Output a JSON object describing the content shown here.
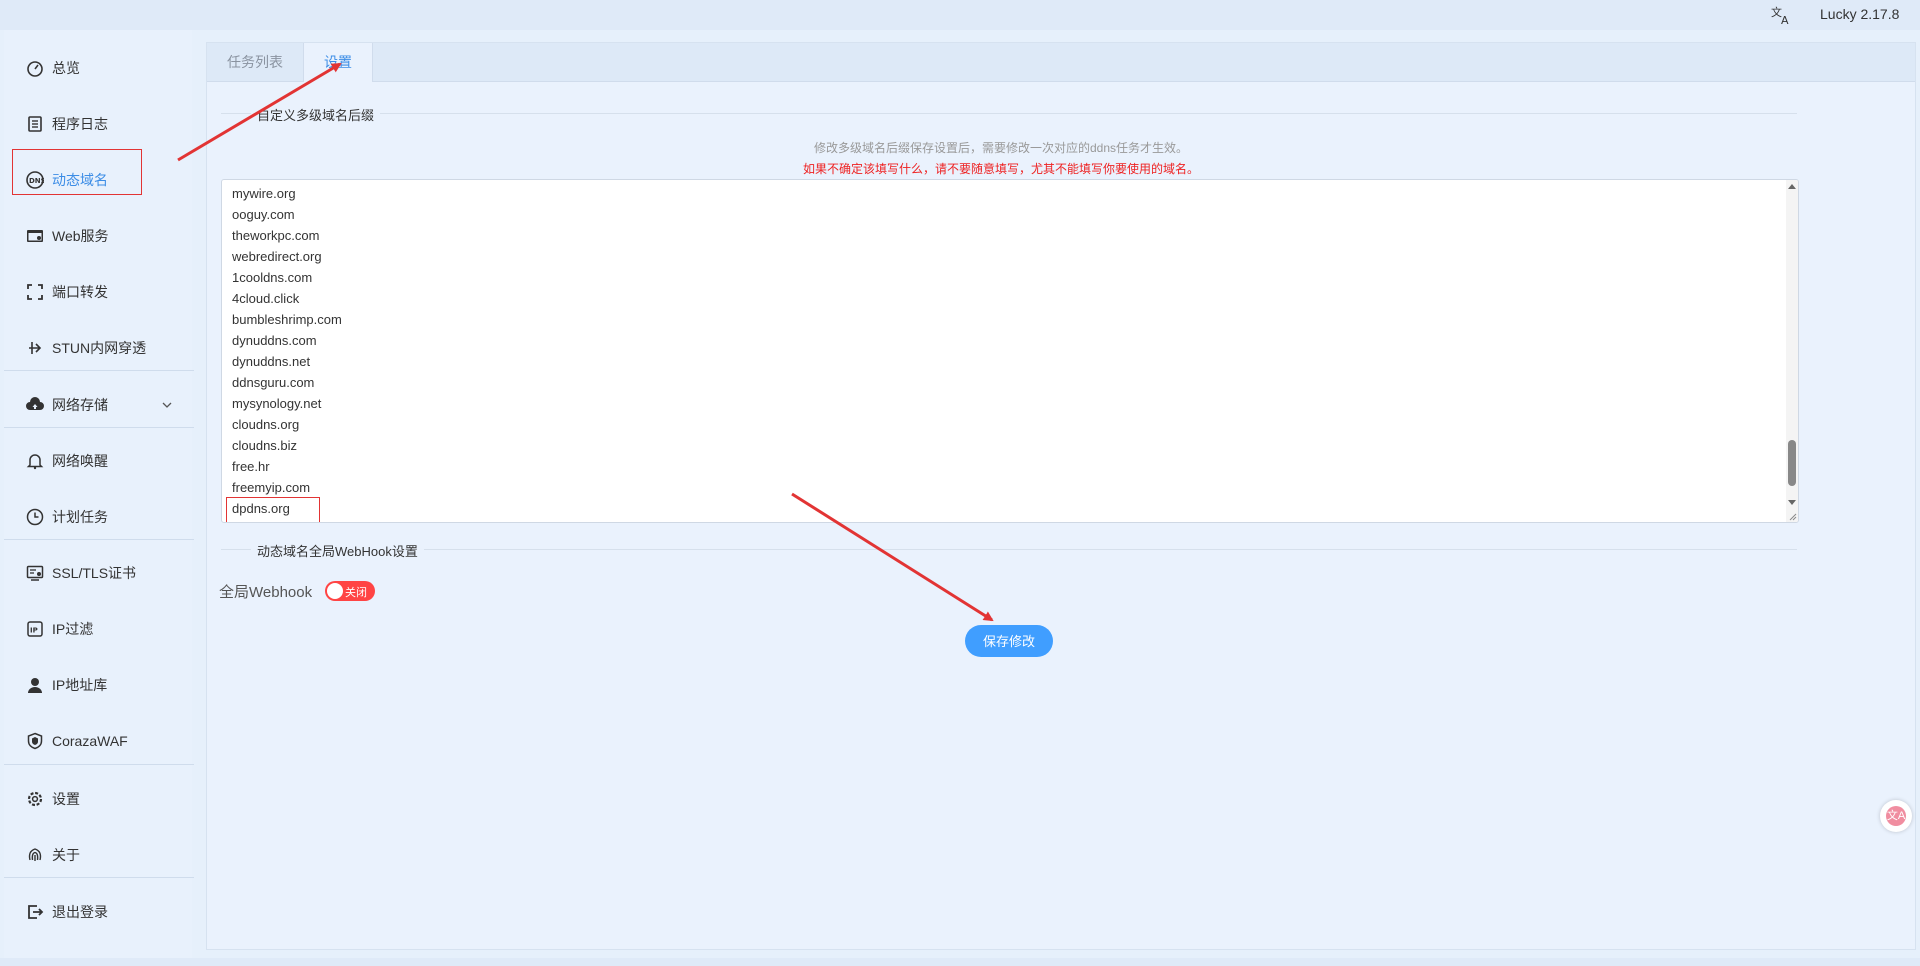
{
  "topbar": {
    "version": "Lucky 2.17.8",
    "translate_icon": "translate-icon"
  },
  "sidebar": {
    "items": [
      {
        "label": "总览",
        "icon": "dashboard-icon"
      },
      {
        "label": "程序日志",
        "icon": "log-icon"
      },
      {
        "label": "动态域名",
        "icon": "dns-icon",
        "active": true
      },
      {
        "label": "Web服务",
        "icon": "web-icon"
      },
      {
        "label": "端口转发",
        "icon": "port-forward-icon"
      },
      {
        "label": "STUN内网穿透",
        "icon": "stun-icon"
      },
      {
        "label": "网络存储",
        "icon": "cloud-upload-icon",
        "expandable": true
      },
      {
        "label": "网络唤醒",
        "icon": "bell-icon"
      },
      {
        "label": "计划任务",
        "icon": "clock-icon"
      },
      {
        "label": "SSL/TLS证书",
        "icon": "certificate-icon"
      },
      {
        "label": "IP过滤",
        "icon": "ip-filter-icon"
      },
      {
        "label": "IP地址库",
        "icon": "user-location-icon"
      },
      {
        "label": "CorazaWAF",
        "icon": "shield-icon"
      },
      {
        "label": "设置",
        "icon": "gear-icon"
      },
      {
        "label": "关于",
        "icon": "fingerprint-icon"
      },
      {
        "label": "退出登录",
        "icon": "logout-icon"
      }
    ]
  },
  "main": {
    "tabs": [
      {
        "label": "任务列表"
      },
      {
        "label": "设置",
        "active": true
      }
    ],
    "section1_title": "自定义多级域名后缀",
    "hint_gray": "修改多级域名后缀保存设置后，需要修改一次对应的ddns任务才生效。",
    "hint_red": "如果不确定该填写什么，请不要随意填写，尤其不能填写你要使用的域名。",
    "domains": [
      "mywire.org",
      "ooguy.com",
      "theworkpc.com",
      "webredirect.org",
      "1cooldns.com",
      "4cloud.click",
      "bumbleshrimp.com",
      "dynuddns.com",
      "dynuddns.net",
      "ddnsguru.com",
      "mysynology.net",
      "cloudns.org",
      "cloudns.biz",
      "free.hr",
      "freemyip.com",
      "dpdns.org"
    ],
    "section2_title": "动态域名全局WebHook设置",
    "webhook_label": "全局Webhook",
    "toggle_text": "关闭",
    "toggle_on": false,
    "save_label": "保存修改"
  },
  "colors": {
    "accent": "#409eff",
    "annotation": "#e23434",
    "toggle_off": "#ff4444"
  }
}
